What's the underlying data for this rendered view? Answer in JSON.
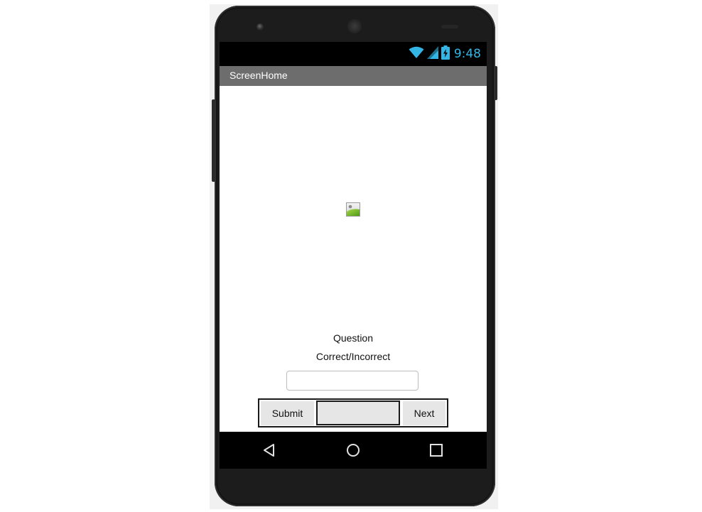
{
  "status_bar": {
    "time": "9:48",
    "icons": [
      "wifi-icon",
      "cell-signal-icon",
      "battery-charging-icon"
    ],
    "accent_color": "#33b5e5"
  },
  "app": {
    "title": "ScreenHome"
  },
  "content": {
    "image_icon": "broken-image-icon",
    "question_label": "Question",
    "result_label": "Correct/Incorrect",
    "answer_input": {
      "value": "",
      "placeholder": ""
    },
    "buttons": {
      "submit": "Submit",
      "middle": "",
      "next": "Next"
    }
  },
  "nav_bar": {
    "icons": [
      "back-icon",
      "home-icon",
      "recents-icon"
    ]
  }
}
